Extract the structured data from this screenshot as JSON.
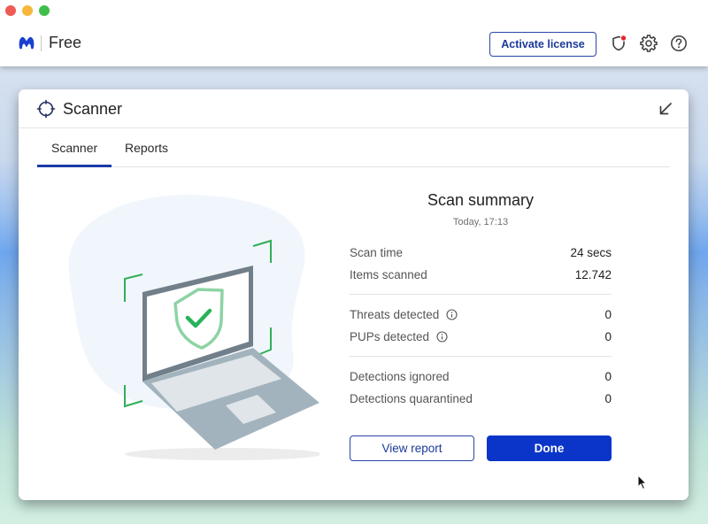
{
  "window": {
    "controls": [
      "close",
      "minimize",
      "maximize"
    ]
  },
  "app": {
    "brand": "Free",
    "activate_label": "Activate license",
    "icons": [
      "shield-alert-icon",
      "gear-icon",
      "help-icon"
    ],
    "alert_dot_color": "#e0262b",
    "accent": "#0b35c9"
  },
  "card": {
    "title": "Scanner",
    "tabs": [
      {
        "label": "Scanner",
        "active": true
      },
      {
        "label": "Reports",
        "active": false
      }
    ]
  },
  "summary": {
    "title": "Scan summary",
    "date": "Today, 17:13",
    "groups": [
      [
        {
          "label": "Scan time",
          "value": "24 secs"
        },
        {
          "label": "Items scanned",
          "value": "12.742"
        }
      ],
      [
        {
          "label": "Threats detected",
          "value": "0",
          "info": true
        },
        {
          "label": "PUPs detected",
          "value": "0",
          "info": true
        }
      ],
      [
        {
          "label": "Detections ignored",
          "value": "0"
        },
        {
          "label": "Detections quarantined",
          "value": "0"
        }
      ]
    ],
    "view_report_label": "View report",
    "done_label": "Done"
  }
}
